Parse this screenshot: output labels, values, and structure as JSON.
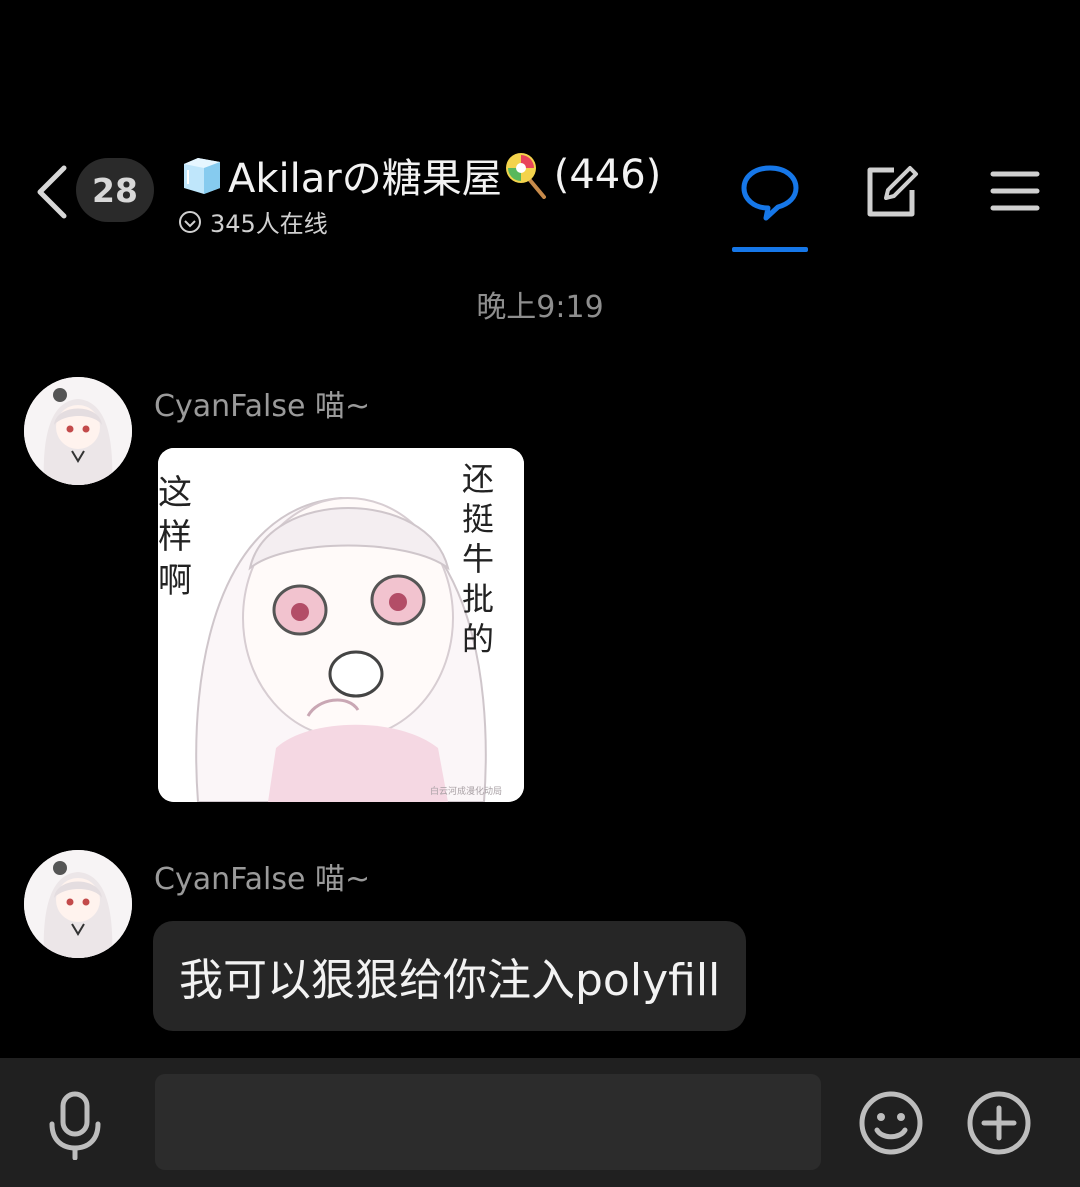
{
  "header": {
    "unread_count": "28",
    "group_name": "Akilarの糖果屋",
    "member_count": "(446)",
    "online_status": "345人在线"
  },
  "chat": {
    "timestamp": "晚上9:19",
    "messages": [
      {
        "sender": "CyanFalse 喵~",
        "type": "sticker",
        "sticker_text_left": "这样啊",
        "sticker_text_right": "还挺牛批的",
        "sticker_watermark": "白云河成漫化动局"
      },
      {
        "sender": "CyanFalse 喵~",
        "type": "text",
        "text": "我可以狠狠给你注入polyfill"
      }
    ]
  },
  "input_bar": {
    "placeholder": ""
  },
  "colors": {
    "accent": "#1677e8",
    "background": "#000000",
    "bubble": "#262626",
    "input_bar": "#202020"
  },
  "icons": [
    "back-icon",
    "ice-cube-icon",
    "lollipop-icon",
    "online-check-icon",
    "chat-bubble-icon",
    "edit-icon",
    "menu-icon",
    "microphone-icon",
    "emoji-icon",
    "plus-icon"
  ]
}
